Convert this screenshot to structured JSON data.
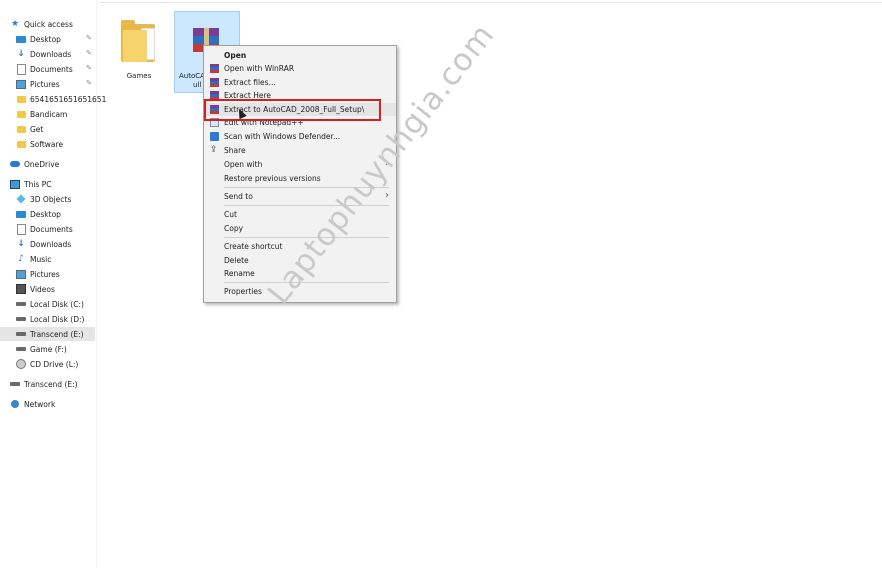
{
  "nav": {
    "items": [
      {
        "label": "Quick access",
        "icon": "star-icon",
        "pinned": false
      },
      {
        "label": "Desktop",
        "icon": "desktop-icon",
        "pinned": true
      },
      {
        "label": "Downloads",
        "icon": "download-icon",
        "pinned": true
      },
      {
        "label": "Documents",
        "icon": "documents-icon",
        "pinned": true
      },
      {
        "label": "Pictures",
        "icon": "pictures-icon",
        "pinned": true
      },
      {
        "label": "6541651651651651",
        "icon": "folder-icon",
        "pinned": false
      },
      {
        "label": "Bandicam",
        "icon": "folder-icon",
        "pinned": false
      },
      {
        "label": "Get",
        "icon": "folder-icon",
        "pinned": false
      },
      {
        "label": "Software",
        "icon": "folder-icon",
        "pinned": false
      },
      {
        "label": "OneDrive",
        "icon": "onedrive-icon",
        "pinned": false
      },
      {
        "label": "This PC",
        "icon": "this-pc-icon",
        "pinned": false
      },
      {
        "label": "3D Objects",
        "icon": "3d-objects-icon",
        "pinned": false
      },
      {
        "label": "Desktop",
        "icon": "desktop-icon",
        "pinned": false
      },
      {
        "label": "Documents",
        "icon": "documents-icon",
        "pinned": false
      },
      {
        "label": "Downloads",
        "icon": "download-icon",
        "pinned": false
      },
      {
        "label": "Music",
        "icon": "music-icon",
        "pinned": false
      },
      {
        "label": "Pictures",
        "icon": "pictures-icon",
        "pinned": false
      },
      {
        "label": "Videos",
        "icon": "videos-icon",
        "pinned": false
      },
      {
        "label": "Local Disk (C:)",
        "icon": "drive-icon",
        "pinned": false
      },
      {
        "label": "Local Disk (D:)",
        "icon": "drive-icon",
        "pinned": false
      },
      {
        "label": "Transcend (E:)",
        "icon": "drive-icon",
        "pinned": false,
        "selected": true
      },
      {
        "label": "Game (F:)",
        "icon": "drive-icon",
        "pinned": false
      },
      {
        "label": "CD Drive (L:)",
        "icon": "cd-drive-icon",
        "pinned": false
      },
      {
        "label": "Transcend (E:)",
        "icon": "drive-icon",
        "pinned": false
      },
      {
        "label": "Network",
        "icon": "network-icon",
        "pinned": false
      }
    ]
  },
  "files": [
    {
      "name": "Games",
      "icon": "folder-icon"
    },
    {
      "name_line1": "AutoCA",
      "name_line2": "ull",
      "icon": "winrar-archive-icon",
      "selected": true
    }
  ],
  "context_menu": {
    "items": [
      {
        "label": "Open",
        "bold": true,
        "icon": ""
      },
      {
        "label": "Open with WinRAR",
        "icon": "winrar-icon"
      },
      {
        "label": "Extract files...",
        "icon": "winrar-icon"
      },
      {
        "label": "Extract Here",
        "icon": "winrar-icon"
      },
      {
        "label": "Extract to AutoCAD_2008_Full_Setup\\",
        "icon": "winrar-icon",
        "highlighted": true
      },
      {
        "label": "Edit with Notepad++",
        "icon": "notepad-icon"
      },
      {
        "label": "Scan with Windows Defender...",
        "icon": "defender-icon"
      },
      {
        "label": "Share",
        "icon": "share-icon"
      },
      {
        "label": "Open with",
        "icon": "",
        "submenu": true
      },
      {
        "label": "Restore previous versions",
        "icon": ""
      },
      {
        "label": "Send to",
        "icon": "",
        "submenu": true
      },
      {
        "label": "Cut",
        "icon": ""
      },
      {
        "label": "Copy",
        "icon": ""
      },
      {
        "label": "Create shortcut",
        "icon": ""
      },
      {
        "label": "Delete",
        "icon": ""
      },
      {
        "label": "Rename",
        "icon": ""
      },
      {
        "label": "Properties",
        "icon": ""
      }
    ]
  },
  "watermark": "Laptophuynhgia.com",
  "colors": {
    "highlight_box": "#d81e1e",
    "selection": "#cce8ff",
    "menu_bg": "#f2f2f2"
  }
}
